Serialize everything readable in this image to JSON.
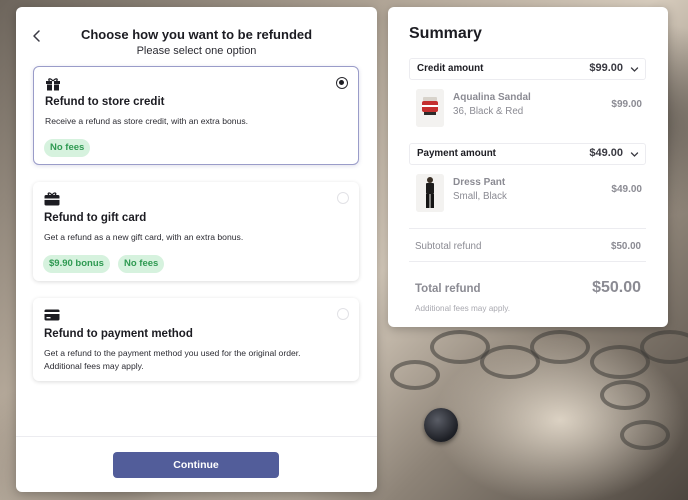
{
  "left": {
    "title": "Choose how you want to be refunded",
    "subtitle": "Please select one option",
    "options": [
      {
        "icon": "gift-icon",
        "title": "Refund to store credit",
        "description": "Receive a refund as store credit, with an extra bonus.",
        "badges": [
          "No fees"
        ],
        "selected": true
      },
      {
        "icon": "gift-card-icon",
        "title": "Refund to gift card",
        "description": "Get a refund as a new gift card, with an extra bonus.",
        "badges": [
          "$9.90 bonus",
          "No fees"
        ],
        "selected": false
      },
      {
        "icon": "credit-card-icon",
        "title": "Refund to payment method",
        "description_lines": [
          "Get a refund to the payment method you used for the original order.",
          "Additional fees may apply."
        ],
        "selected": false
      }
    ],
    "continue_label": "Continue"
  },
  "summary": {
    "title": "Summary",
    "credit": {
      "label": "Credit amount",
      "amount": "$99.00",
      "item": {
        "name": "Aqualina Sandal",
        "variant": "36, Black & Red",
        "price": "$99.00"
      }
    },
    "payment": {
      "label": "Payment amount",
      "amount": "$49.00",
      "item": {
        "name": "Dress Pant",
        "variant": "Small, Black",
        "price": "$49.00"
      }
    },
    "subtotal_label": "Subtotal refund",
    "subtotal_amount": "$50.00",
    "total_label": "Total refund",
    "total_amount": "$50.00",
    "fees_note": "Additional fees may apply."
  },
  "colors": {
    "accent": "#525d9a",
    "badge_bg": "#d6f2de",
    "badge_text": "#2f9a52",
    "selected_border": "#9a9cc9"
  }
}
